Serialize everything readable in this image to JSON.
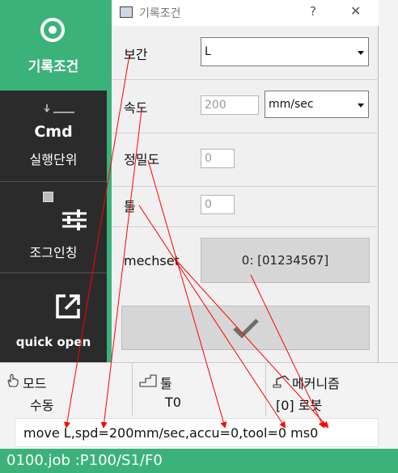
{
  "sidebar": {
    "record_condition": "기록조건",
    "cmd": "Cmd",
    "cmd_sub": "실행단위",
    "jog_inching": "조그인칭",
    "quick_open": "quick open"
  },
  "dialog": {
    "title": "기록조건",
    "help": "?",
    "close": "✕",
    "interp_label": "보간",
    "interp_value": "L",
    "speed_label": "속도",
    "speed_value": "200",
    "speed_unit": "mm/sec",
    "accuracy_label": "정밀도",
    "accuracy_value": "0",
    "tool_label": "툴",
    "tool_value": "0",
    "mechset_label": "mechset",
    "mechset_value": "0: [01234567]"
  },
  "status": {
    "mode_title": "모드",
    "mode_value": "수동",
    "tool_title": "툴",
    "tool_value": "T0",
    "mech_title": "메커니즘",
    "mech_value": "[0] 로봇"
  },
  "command_line": "move L,spd=200mm/sec,accu=0,tool=0 ms0",
  "footer": "0100.job  :P100/S1/F0",
  "colors": {
    "accent": "#3ab27a",
    "sidebar": "#2b2b2b",
    "annotation": "#ff0000"
  }
}
